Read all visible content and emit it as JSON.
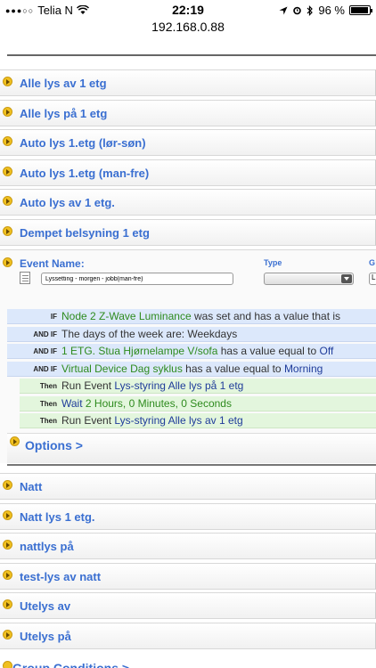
{
  "status_bar": {
    "carrier": "Telia N",
    "signal": "●●●○○",
    "time": "22:19",
    "battery": "96 %",
    "battery_level": 0.96,
    "url": "192.168.0.88"
  },
  "events_top": [
    {
      "label": "Alle lys av 1 etg"
    },
    {
      "label": "Alle lys på 1 etg"
    },
    {
      "label": "Auto lys 1.etg (lør-søn)"
    },
    {
      "label": "Auto lys 1.etg (man-fre)"
    },
    {
      "label": "Auto lys av 1 etg."
    },
    {
      "label": "Dempet belsyning 1 etg"
    }
  ],
  "editor": {
    "event_name_label": "Event Name:",
    "type_label": "Type",
    "g_label": "G",
    "event_name_value": "Lyssetting - morgen - jobb(man-fre)",
    "g_value": "L",
    "conditions": [
      {
        "kw": "IF",
        "parts": [
          [
            "g",
            "Node 2 Z-Wave Luminance"
          ],
          [
            "dk",
            " was set and has a value that is"
          ]
        ]
      },
      {
        "kw": "AND IF",
        "parts": [
          [
            "dk",
            "The days of the week are: Weekdays"
          ]
        ]
      },
      {
        "kw": "AND IF",
        "parts": [
          [
            "g",
            "1 ETG. Stua Hjørnelampe V/sofa"
          ],
          [
            "dk",
            " has a value equal to "
          ],
          [
            "nv",
            "Off"
          ]
        ]
      },
      {
        "kw": "AND IF",
        "parts": [
          [
            "g",
            "Virtual Device Dag syklus"
          ],
          [
            "dk",
            " has a value equal to "
          ],
          [
            "nv",
            "Morning"
          ]
        ]
      }
    ],
    "actions": [
      {
        "kw": "Then",
        "parts": [
          [
            "dk",
            "Run Event "
          ],
          [
            "nv",
            "Lys-styring Alle lys på 1 etg"
          ]
        ]
      },
      {
        "kw": "Then",
        "parts": [
          [
            "nv",
            "Wait "
          ],
          [
            "g",
            "2 Hours, 0 Minutes, 0 Seconds"
          ]
        ]
      },
      {
        "kw": "Then",
        "parts": [
          [
            "dk",
            "Run Event "
          ],
          [
            "nv",
            "Lys-styring Alle lys av 1 etg"
          ]
        ]
      }
    ],
    "options_label": "Options >"
  },
  "events_bottom": [
    {
      "label": "Natt"
    },
    {
      "label": "Natt lys 1 etg."
    },
    {
      "label": "nattlys på"
    },
    {
      "label": "test-lys av natt"
    },
    {
      "label": "Utelys av"
    },
    {
      "label": "Utelys på"
    }
  ],
  "group_conditions_label": "Group Conditions >"
}
